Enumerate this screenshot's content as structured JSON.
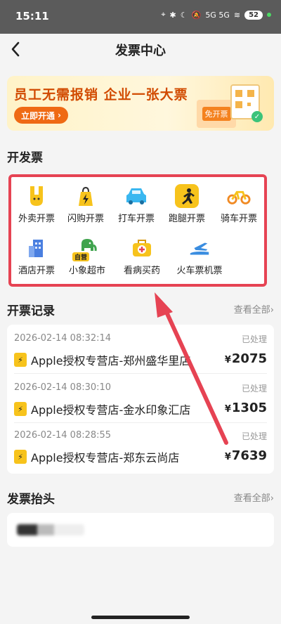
{
  "status_bar": {
    "time": "15:11",
    "network": "5G 5G",
    "battery": "52"
  },
  "nav": {
    "title": "发票中心"
  },
  "banner": {
    "headline": "员工无需报销 企业一张大票",
    "cta": "立即开通",
    "badge": "免开票"
  },
  "open_invoice": {
    "title": "开发票",
    "items": [
      {
        "label": "外卖开票",
        "icon": "takeout-icon",
        "color": "#f7c31c"
      },
      {
        "label": "闪购开票",
        "icon": "flash-bag-icon",
        "color": "#f7c31c"
      },
      {
        "label": "打车开票",
        "icon": "car-icon",
        "color": "#3ab7f0"
      },
      {
        "label": "跑腿开票",
        "icon": "runner-icon",
        "color": "#f7c31c"
      },
      {
        "label": "骑车开票",
        "icon": "bike-icon",
        "color": "#f08a24"
      },
      {
        "label": "酒店开票",
        "icon": "hotel-icon",
        "color": "#4a7fe0"
      },
      {
        "label": "小象超市",
        "icon": "elephant-icon",
        "color": "#3fa34d",
        "tag": "自营"
      },
      {
        "label": "看病买药",
        "icon": "medicine-icon",
        "color": "#f7c31c"
      },
      {
        "label": "火车票机票",
        "icon": "train-plane-icon",
        "color": "#3a8de0"
      }
    ]
  },
  "records": {
    "title": "开票记录",
    "see_all": "查看全部",
    "items": [
      {
        "time": "2026-02-14 08:32:14",
        "status": "已处理",
        "store": "Apple授权专营店-郑州盛华里店",
        "currency": "¥",
        "amount": "2075"
      },
      {
        "time": "2026-02-14 08:30:10",
        "status": "已处理",
        "store": "Apple授权专营店-金水印象汇店",
        "currency": "¥",
        "amount": "1305"
      },
      {
        "time": "2026-02-14 08:28:55",
        "status": "已处理",
        "store": "Apple授权专营店-郑东云尚店",
        "currency": "¥",
        "amount": "7639"
      }
    ]
  },
  "invoice_header": {
    "title": "发票抬头",
    "see_all": "查看全部"
  },
  "colors": {
    "highlight_border": "#e64353",
    "arrow": "#e64353",
    "accent": "#ef6a14"
  }
}
